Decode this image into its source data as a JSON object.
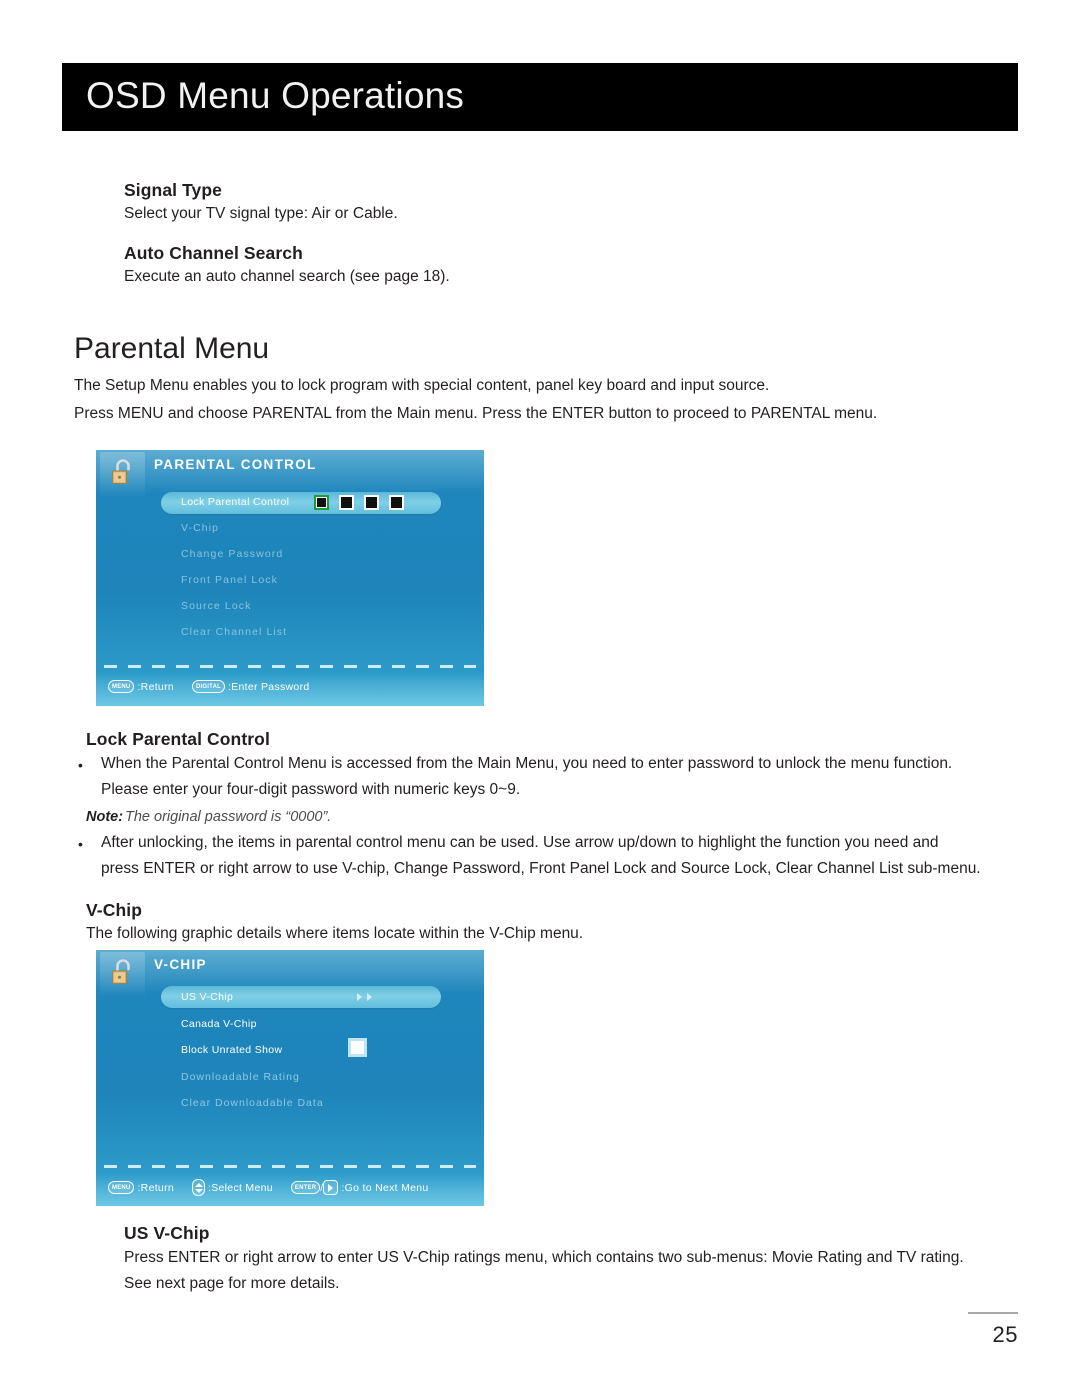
{
  "header": {
    "title": "OSD Menu Operations"
  },
  "sections": {
    "signal_type": {
      "heading": "Signal Type",
      "body": "Select your TV signal type: Air or Cable."
    },
    "auto_channel_search": {
      "heading": "Auto Channel Search",
      "body": "Execute an auto channel search (see page 18)."
    },
    "parental_menu": {
      "heading": "Parental Menu",
      "intro_line1": "The Setup Menu enables you to lock program with special content, panel key board and input source.",
      "intro_line2": "Press MENU and choose PARENTAL from the Main menu. Press the ENTER button to proceed to PARENTAL menu."
    },
    "lock_parental_control": {
      "heading": "Lock Parental Control",
      "bullet1_line1": "When the Parental Control Menu is accessed from the Main Menu, you need to enter password to unlock the menu function.",
      "bullet1_line2": "Please enter your four-digit password with numeric keys 0~9.",
      "note_label": "Note:",
      "note_text": "The original password is “0000”.",
      "bullet2_line1": "After unlocking, the items in parental control menu can be used. Use arrow up/down to highlight the function you need and",
      "bullet2_line2": "press ENTER or right arrow to use V-chip, Change Password, Front Panel Lock and Source Lock, Clear Channel List sub-menu."
    },
    "v_chip": {
      "heading": "V-Chip",
      "body": "The following graphic details where items locate within the V-Chip menu."
    },
    "us_v_chip": {
      "heading": "US V-Chip",
      "body_line1": "Press ENTER or right arrow to enter US V-Chip ratings menu, which contains two sub-menus: Movie Rating and TV rating.",
      "body_line2": "See next page for more details."
    }
  },
  "osd_parental": {
    "title": "PARENTAL CONTROL",
    "icon": "open-padlock-icon",
    "items": [
      {
        "label": "Lock Parental Control",
        "state": "selected"
      },
      {
        "label": "V-Chip",
        "state": "dimmed"
      },
      {
        "label": "Change Password",
        "state": "dimmed"
      },
      {
        "label": "Front Panel Lock",
        "state": "dimmed"
      },
      {
        "label": "Source Lock",
        "state": "dimmed"
      },
      {
        "label": "Clear Channel List",
        "state": "dimmed"
      }
    ],
    "password_boxes": 4,
    "password_active_index": 0,
    "hints": [
      {
        "key": "MENU",
        "label": ":Return"
      },
      {
        "key": "DIGITAL",
        "label": ":Enter Password"
      }
    ]
  },
  "osd_vchip": {
    "title": "V-CHIP",
    "icon": "open-padlock-icon",
    "items": [
      {
        "label": "US V-Chip",
        "state": "selected"
      },
      {
        "label": "Canada V-Chip",
        "state": "normal"
      },
      {
        "label": "Block Unrated Show",
        "state": "normal"
      },
      {
        "label": "Downloadable Rating",
        "state": "dimmed"
      },
      {
        "label": "Clear Downloadable Data",
        "state": "dimmed"
      }
    ],
    "block_unrated_checked": false,
    "hints": [
      {
        "key": "MENU",
        "label": ":Return"
      },
      {
        "key": "UPDOWN",
        "label": ":Select Menu"
      },
      {
        "key": "ENTER",
        "label": ":Go to Next Menu",
        "separator": "/"
      }
    ]
  },
  "footer": {
    "page_number": "25"
  },
  "colors": {
    "header_bg": "#000000",
    "osd_blue": "#1f86bd",
    "osd_highlight": "#7fd0e6",
    "selection_green": "#1e9b3c",
    "text": "#231f20"
  }
}
